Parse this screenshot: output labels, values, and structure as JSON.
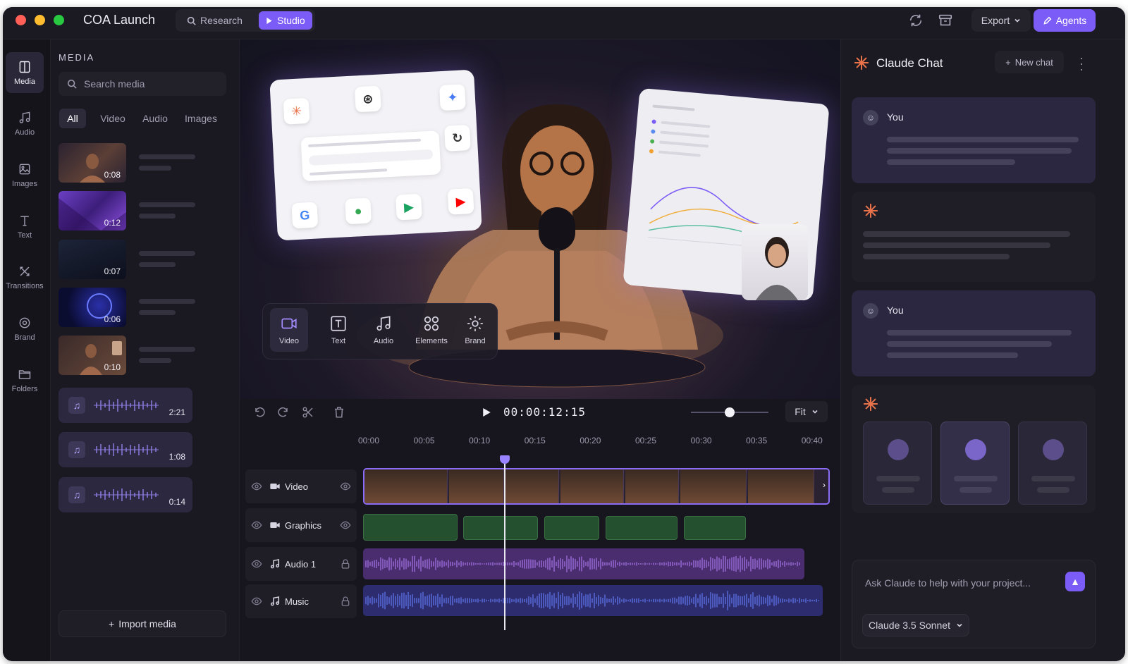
{
  "app": {
    "title": "COA Launch"
  },
  "modes": {
    "research": "Research",
    "studio": "Studio"
  },
  "toolbar": {
    "export": "Export",
    "agents": "Agents"
  },
  "rail": [
    {
      "label": "Media",
      "icon": "media-icon",
      "active": true
    },
    {
      "label": "Audio",
      "icon": "music-note-icon"
    },
    {
      "label": "Images",
      "icon": "image-icon"
    },
    {
      "label": "Text",
      "icon": "text-icon"
    },
    {
      "label": "Transitions",
      "icon": "transitions-icon"
    },
    {
      "label": "Brand",
      "icon": "brand-icon"
    },
    {
      "label": "Folders",
      "icon": "folder-icon"
    }
  ],
  "media": {
    "heading": "MEDIA",
    "search_placeholder": "Search media",
    "filters": [
      "All",
      "Video",
      "Audio",
      "Images"
    ],
    "active_filter": "All",
    "videos": [
      {
        "duration": "0:08"
      },
      {
        "duration": "0:12"
      },
      {
        "duration": "0:07"
      },
      {
        "duration": "0:06"
      },
      {
        "duration": "0:10"
      }
    ],
    "audio": [
      {
        "duration": "2:21"
      },
      {
        "duration": "1:08"
      },
      {
        "duration": "0:14"
      }
    ],
    "import_label": "Import media"
  },
  "tools": [
    {
      "label": "Video",
      "icon": "video-camera-icon",
      "active": true
    },
    {
      "label": "Text",
      "icon": "text-box-icon"
    },
    {
      "label": "Audio",
      "icon": "music-note-icon"
    },
    {
      "label": "Elements",
      "icon": "elements-icon"
    },
    {
      "label": "Brand",
      "icon": "brand-gear-icon"
    }
  ],
  "transport": {
    "timecode": "00:00:12:15",
    "zoom": "Fit",
    "zoom_level": 0.5
  },
  "timeline": {
    "ruler": [
      "00:00",
      "00:05",
      "00:10",
      "00:15",
      "00:20",
      "00:25",
      "00:30",
      "00:35",
      "00:40"
    ],
    "tracks": [
      {
        "name": "Video",
        "icon": "video-camera-icon",
        "right": "eye-icon"
      },
      {
        "name": "Graphics",
        "icon": "video-camera-icon",
        "right": "eye-icon"
      },
      {
        "name": "Audio 1",
        "icon": "music-note-icon",
        "right": "lock-icon"
      },
      {
        "name": "Music",
        "icon": "music-note-icon",
        "right": "lock-icon"
      }
    ]
  },
  "chat": {
    "title": "Claude Chat",
    "new_chat": "New chat",
    "messages": [
      {
        "role": "user",
        "name": "You"
      },
      {
        "role": "assistant"
      },
      {
        "role": "user",
        "name": "You"
      },
      {
        "role": "assistant"
      }
    ],
    "input_placeholder": "Ask Claude to help with your project...",
    "model": "Claude 3.5 Sonnet"
  },
  "colors": {
    "accent": "#7c5cf6",
    "claude_orange": "#e8734a",
    "graphics_green": "#25502f"
  }
}
